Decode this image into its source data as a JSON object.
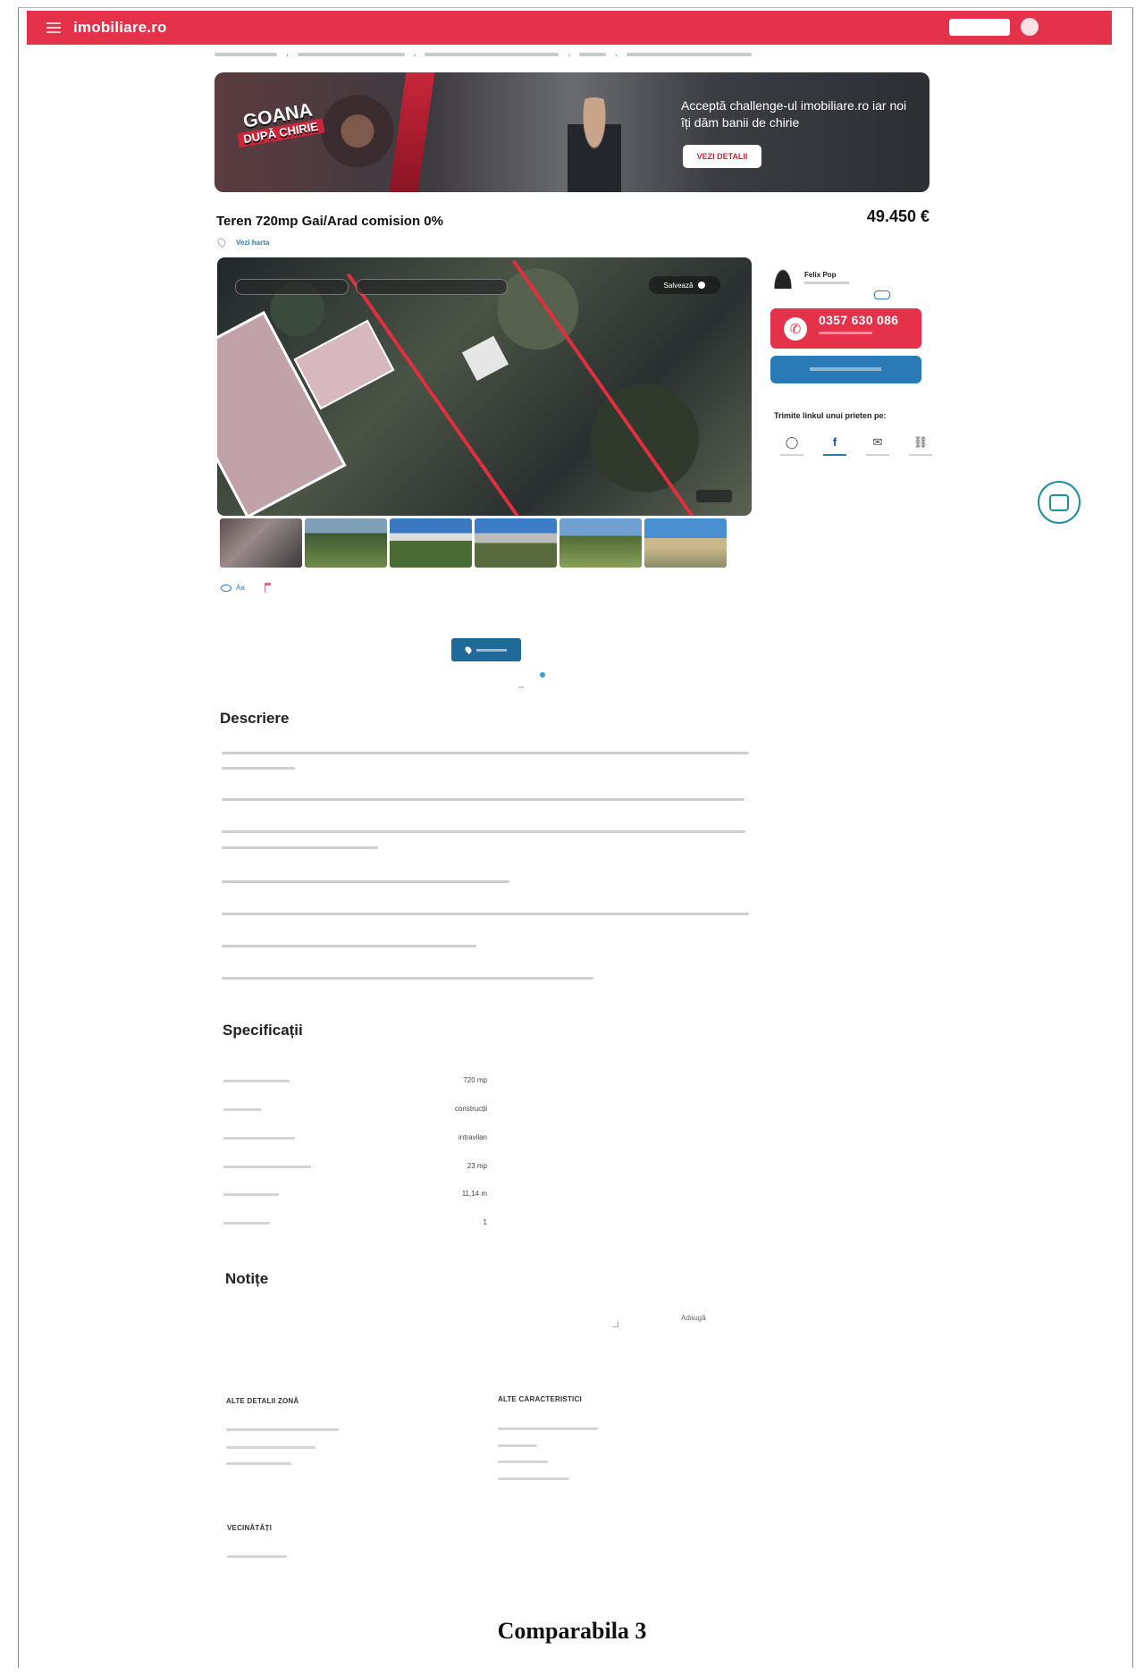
{
  "site": {
    "logo": "imobiliare.ro",
    "add_listing_label": "",
    "account_label": ""
  },
  "breadcrumb": {
    "items": [
      "",
      "",
      "",
      "",
      ""
    ],
    "separator": "›",
    "share_label": ""
  },
  "banner": {
    "badge_line1": "GOANA",
    "badge_line2": "DUPĂ CHIRIE",
    "text": "Acceptă challenge-ul imobiliare.ro iar noi îți dăm banii de chirie",
    "cta": "VEZI DETALII"
  },
  "listing": {
    "title": "Teren 720mp Gai/Arad comision 0%",
    "location": "",
    "view_map": "Vezi harta",
    "price": "49.450 €",
    "price_note": "",
    "price_note_link": ""
  },
  "gallery": {
    "save_label": "Salvează",
    "photo_count": "",
    "thumbnails": [
      "photo-1",
      "photo-2",
      "photo-3",
      "photo-4",
      "photo-5",
      "photo-6"
    ],
    "share_label": "Aa",
    "report_label": ""
  },
  "agent": {
    "name": "Felix Pop",
    "agency": "",
    "phone": "0357 630 086",
    "share_title": "Trimite linkul unui prieten pe:",
    "share_options": [
      {
        "icon": "whatsapp-icon",
        "glyph": "◯"
      },
      {
        "icon": "facebook-icon",
        "glyph": "f"
      },
      {
        "icon": "email-icon",
        "glyph": "✉"
      },
      {
        "icon": "link-icon",
        "glyph": "⛓"
      }
    ]
  },
  "description": {
    "title": "Descriere",
    "read_more": ""
  },
  "specifications": {
    "title": "Specificații",
    "header_left": "",
    "header_right": "",
    "rows": [
      {
        "label": "",
        "value": "720 mp"
      },
      {
        "label": "",
        "value": "construcții"
      },
      {
        "label": "",
        "value": "intravilan"
      },
      {
        "label": "",
        "value": "23 mp"
      },
      {
        "label": "",
        "value": "11,14 m"
      },
      {
        "label": "",
        "value": "1"
      }
    ]
  },
  "notes": {
    "title": "Notițe",
    "add_label": "Adaugă"
  },
  "zone_details": {
    "title": "ALTE DETALII ZONĂ"
  },
  "other_features": {
    "title": "ALTE CARACTERISTICI"
  },
  "neighborhood": {
    "title": "VECINĂTĂȚI"
  },
  "caption": "Comparabila 3",
  "colors": {
    "brand_red": "#e3324a",
    "link_blue": "#2a7ab8",
    "button_blue": "#1f6a9a"
  }
}
